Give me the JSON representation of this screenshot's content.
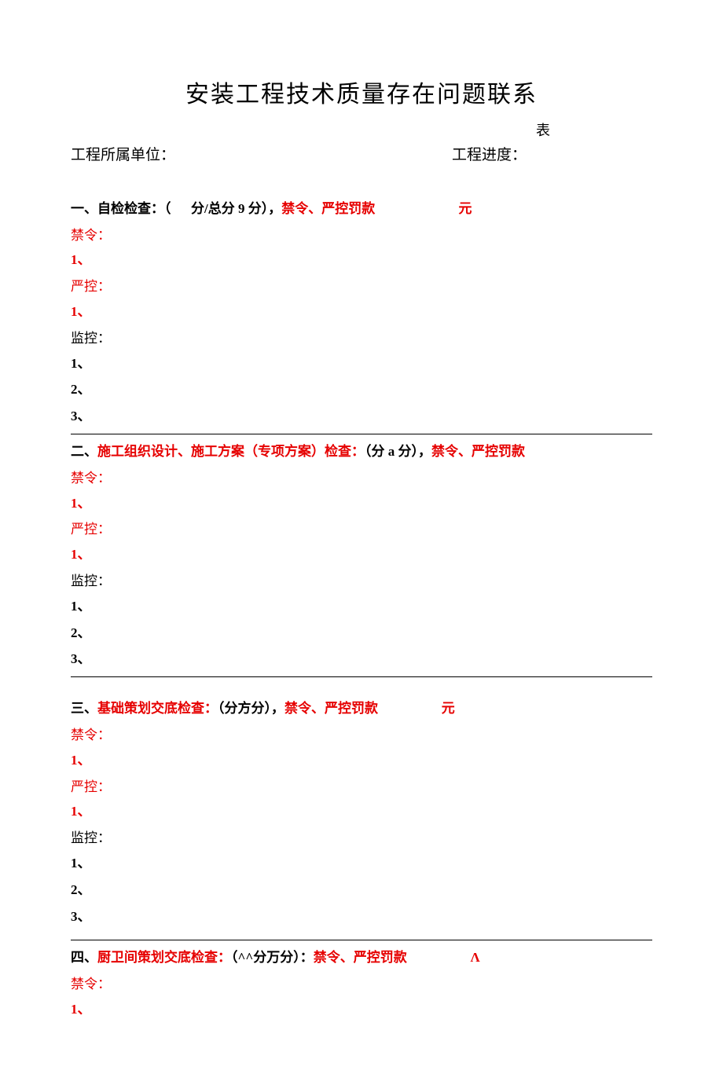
{
  "title": "安装工程技术质量存在问题联系",
  "biao": "表",
  "header": {
    "left": "工程所属单位：",
    "right": "工程进度："
  },
  "sections": [
    {
      "num_black": "一、",
      "label_black": "自检检查：（",
      "mid_black": "      分/总分 9 分），",
      "red_mid": "禁令、严控罚款",
      "tail_red": "                         元",
      "tail_black": "",
      "prohibit_label": "禁令：",
      "prohibit_items": [
        "1、"
      ],
      "strict_label": "严控：",
      "strict_items": [
        "1、"
      ],
      "monitor_label": "监控：",
      "monitor_items": [
        "1、",
        "2、",
        "3、"
      ]
    },
    {
      "num_black": "二、",
      "title_red": "施工组织设计、施工方案（专项方案）检查：",
      "mid_black": "（分 a 分），",
      "red_mid": "禁令、严控罚款",
      "tail_red": "",
      "prohibit_label": "禁令：",
      "prohibit_items": [
        "1、"
      ],
      "strict_label": "严控：",
      "strict_items": [
        "1、"
      ],
      "monitor_label": "监控：",
      "monitor_items": [
        "1、",
        "2、",
        "3、"
      ]
    },
    {
      "num_black": "三、",
      "title_red": "基础策划交底检查：",
      "mid_black": "（分方分），",
      "red_mid": "禁令、严控罚款",
      "tail_red": "                   元",
      "prohibit_label": "禁令：",
      "prohibit_items": [
        "1、"
      ],
      "strict_label": "严控：",
      "strict_items": [
        "1、"
      ],
      "monitor_label": "监控：",
      "monitor_items": [
        "1、",
        "2、",
        "3、"
      ]
    },
    {
      "num_black": "四、",
      "title_red": "厨卫间策划交底检查：",
      "mid_black": "（^^分万分）：",
      "red_mid": "禁令、严控罚款",
      "tail_red": "                   Λ",
      "prohibit_label": "禁令：",
      "prohibit_items": [
        "1、"
      ]
    }
  ]
}
